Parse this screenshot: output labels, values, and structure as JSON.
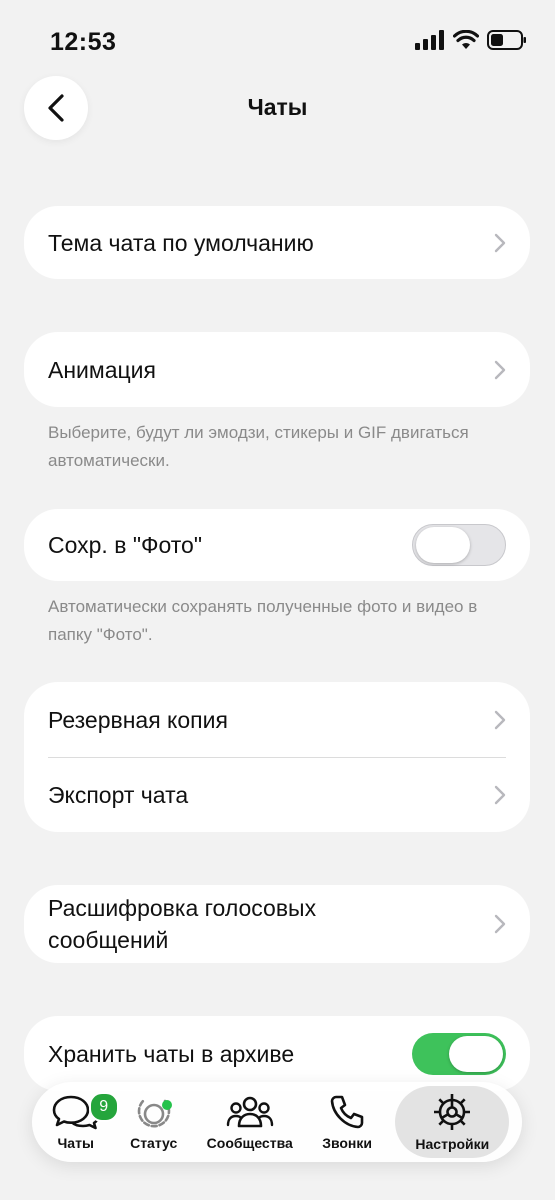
{
  "status_bar": {
    "time": "12:53",
    "icons": [
      "signal-icon",
      "wifi-icon",
      "battery-icon"
    ]
  },
  "header": {
    "title": "Чаты",
    "back_icon": "chevron-left-icon"
  },
  "settings": {
    "chat_theme": {
      "label": "Тема чата по умолчанию"
    },
    "animation": {
      "label": "Анимация",
      "note": "Выберите, будут ли эмодзи, стикеры и GIF двигаться автоматически."
    },
    "save_to_photos": {
      "label": "Сохр. в \"Фото\"",
      "enabled": false,
      "note": "Автоматически сохранять полученные фото и видео в папку \"Фото\"."
    },
    "backup": {
      "label": "Резервная копия"
    },
    "export_chat": {
      "label": "Экспорт чата"
    },
    "voice_transcription": {
      "label": "Расшифровка голосовых сообщений"
    },
    "keep_archived": {
      "label": "Хранить чаты в архиве",
      "enabled": true
    }
  },
  "tabbar": {
    "tabs": [
      {
        "label": "Чаты",
        "icon": "chats-icon",
        "badge": "9"
      },
      {
        "label": "Статус",
        "icon": "status-icon"
      },
      {
        "label": "Сообщества",
        "icon": "communities-icon"
      },
      {
        "label": "Звонки",
        "icon": "phone-icon"
      },
      {
        "label": "Настройки",
        "icon": "settings-gear-icon",
        "active": true
      }
    ]
  },
  "colors": {
    "accent_green": "#3ec25b",
    "badge_green": "#25a53c",
    "background": "#f2f2f2",
    "card": "#ffffff",
    "note_text": "#8a8a8a"
  }
}
